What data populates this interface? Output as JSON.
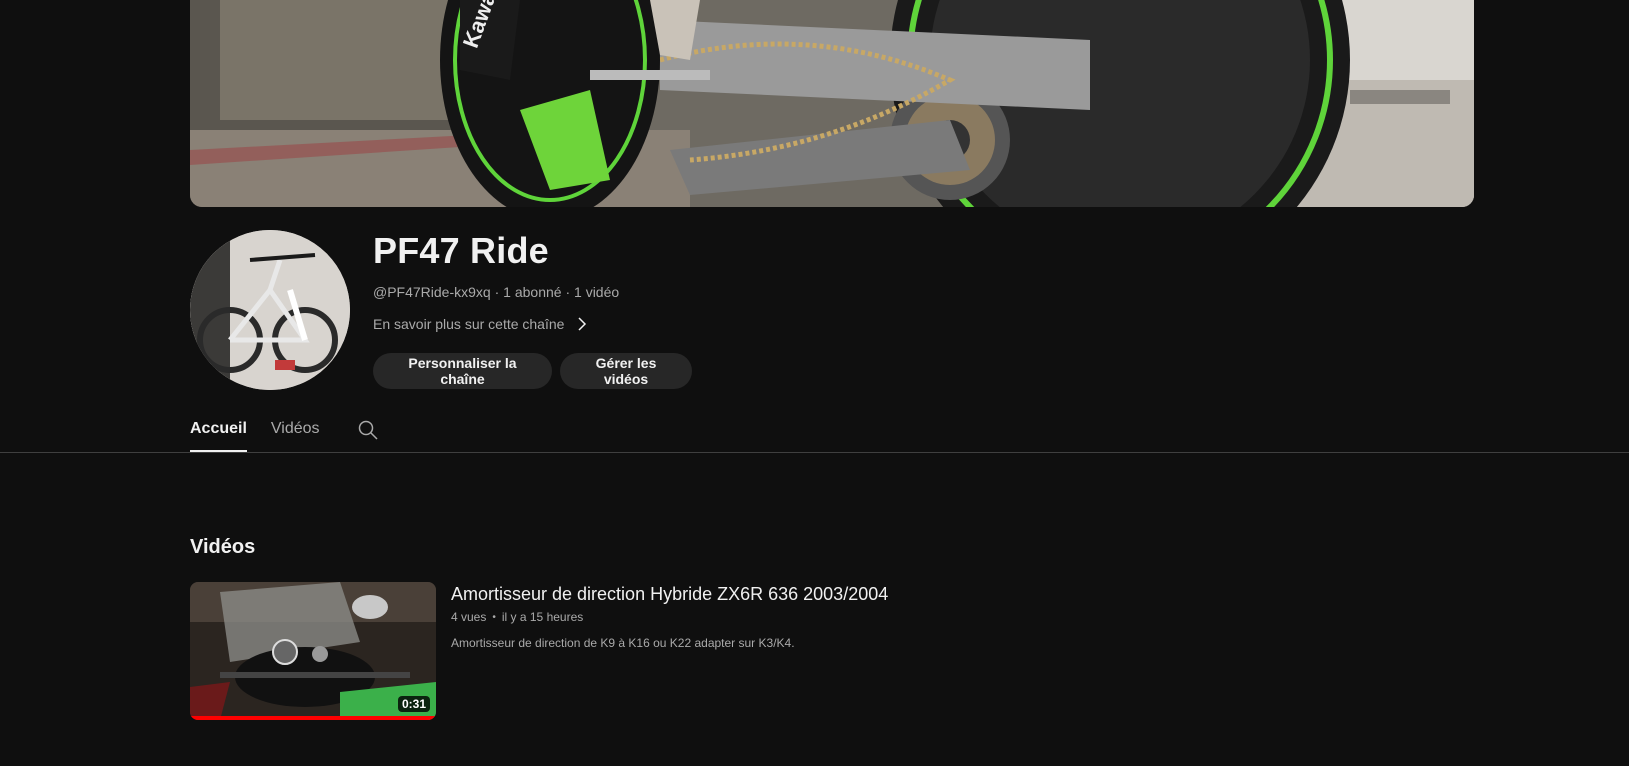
{
  "channel": {
    "name": "PF47 Ride",
    "handle": "@PF47Ride-kx9xq",
    "subscribers": "1 abonné",
    "video_count": "1 vidéo",
    "meta_separator": " · ",
    "about_link": "En savoir plus sur cette chaîne",
    "customize_button": "Personnaliser la chaîne",
    "manage_button": "Gérer les vidéos"
  },
  "tabs": [
    {
      "label": "Accueil",
      "active": true
    },
    {
      "label": "Vidéos",
      "active": false
    }
  ],
  "section": {
    "title": "Vidéos"
  },
  "video": {
    "title": "Amortisseur de direction Hybride ZX6R 636 2003/2004",
    "views": "4 vues",
    "age": "il y a 15 heures",
    "description": "Amortisseur de direction de K9 à K16 ou K22 adapter sur K3/K4.",
    "duration": "0:31",
    "watched_fraction": 1.0
  },
  "icons": {
    "about": "chevron-right-icon",
    "search": "search-icon"
  },
  "colors": {
    "background": "#0f0f0f",
    "button_bg": "#272727",
    "secondary_text": "#aaaaaa",
    "progress": "#ff0000",
    "banner_green": "#5fd43a"
  }
}
